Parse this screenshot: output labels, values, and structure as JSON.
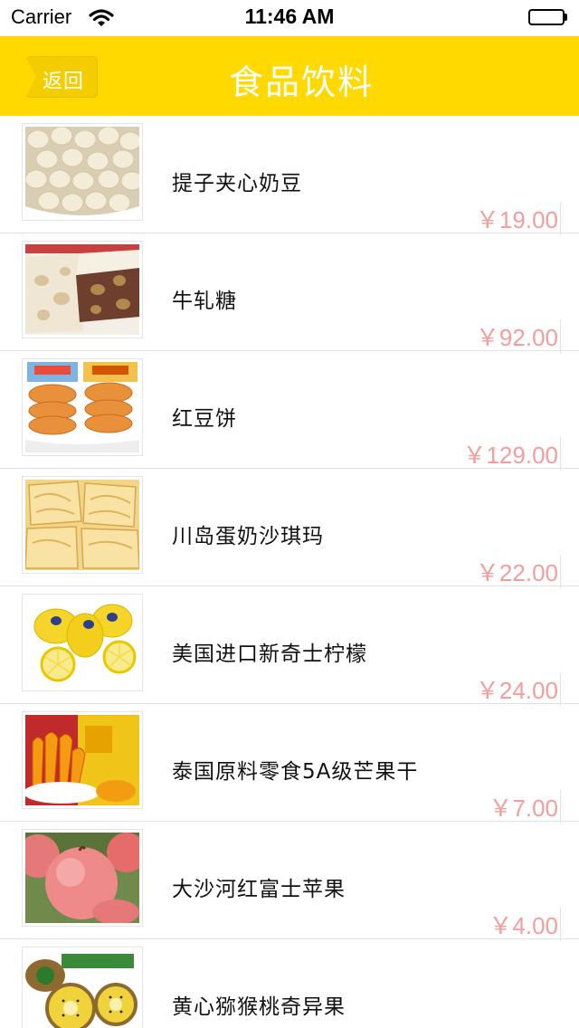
{
  "status_bar": {
    "carrier": "Carrier",
    "time": "11:46 AM"
  },
  "nav": {
    "back_label": "返回",
    "title": "食品饮料",
    "bar_color": "#ffd900"
  },
  "products": [
    {
      "name": "提子夹心奶豆",
      "price": "￥19.00",
      "thumb_icon": "milk-candy-photo"
    },
    {
      "name": "牛轧糖",
      "price": "￥92.00",
      "thumb_icon": "nougat-photo"
    },
    {
      "name": " 红豆饼",
      "price": "￥129.00",
      "thumb_icon": "red-bean-cake-photo"
    },
    {
      "name": "川岛蛋奶沙琪玛",
      "price": "￥22.00",
      "thumb_icon": "sachima-photo"
    },
    {
      "name": "美国进口新奇士柠檬",
      "price": "￥24.00",
      "thumb_icon": "lemon-photo"
    },
    {
      "name": "泰国原料零食5A级芒果干",
      "price": "￥7.00",
      "thumb_icon": "dried-mango-photo"
    },
    {
      "name": "大沙河红富士苹果",
      "price": "￥4.00",
      "thumb_icon": "apple-photo"
    },
    {
      "name": "黄心猕猴桃奇异果",
      "price": "",
      "thumb_icon": "kiwi-photo"
    }
  ],
  "colors": {
    "price": "#f59d9d",
    "separator": "#e2e2e2"
  }
}
